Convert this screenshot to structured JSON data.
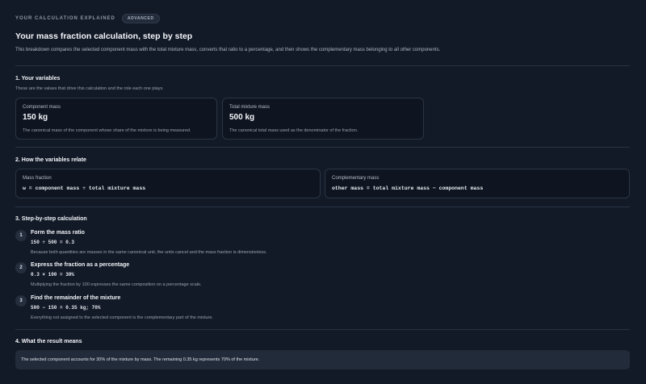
{
  "header": {
    "eyebrow": "YOUR CALCULATION EXPLAINED",
    "badge": "ADVANCED",
    "title": "Your mass fraction calculation, step by step",
    "intro": "This breakdown compares the selected component mass with the total mixture mass, converts that ratio to a percentage, and then shows the complementary mass belonging to all other components."
  },
  "variables": {
    "title": "1. Your variables",
    "subtitle": "These are the values that drive this calculation and the role each one plays.",
    "cards": [
      {
        "label": "Component mass",
        "value": "150 kg",
        "desc": "The canonical mass of the component whose share of the mixture is being measured."
      },
      {
        "label": "Total mixture mass",
        "value": "500 kg",
        "desc": "The canonical total mass used as the denominator of the fraction."
      }
    ]
  },
  "relations": {
    "title": "2. How the variables relate",
    "cards": [
      {
        "label": "Mass fraction",
        "formula": "w = component mass ÷ total mixture mass"
      },
      {
        "label": "Complementary mass",
        "formula": "other mass = total mixture mass − component mass"
      }
    ]
  },
  "steps": {
    "title": "3. Step-by-step calculation",
    "items": [
      {
        "num": "1",
        "title": "Form the mass ratio",
        "math": "150 ÷ 500 = 0.3",
        "desc": "Because both quantities are masses in the same canonical unit, the units cancel and the mass fraction is dimensionless."
      },
      {
        "num": "2",
        "title": "Express the fraction as a percentage",
        "math": "0.3 × 100 = 30%",
        "desc": "Multiplying the fraction by 100 expresses the same composition on a percentage scale."
      },
      {
        "num": "3",
        "title": "Find the remainder of the mixture",
        "math": "500 − 150 = 0.35 kg; 70%",
        "desc": "Everything not assigned to the selected component is the complementary part of the mixture."
      }
    ]
  },
  "meaning": {
    "title": "4. What the result means",
    "text": "The selected component accounts for 30% of the mixture by mass. The remaining 0.35 kg represents 70% of the mixture."
  }
}
